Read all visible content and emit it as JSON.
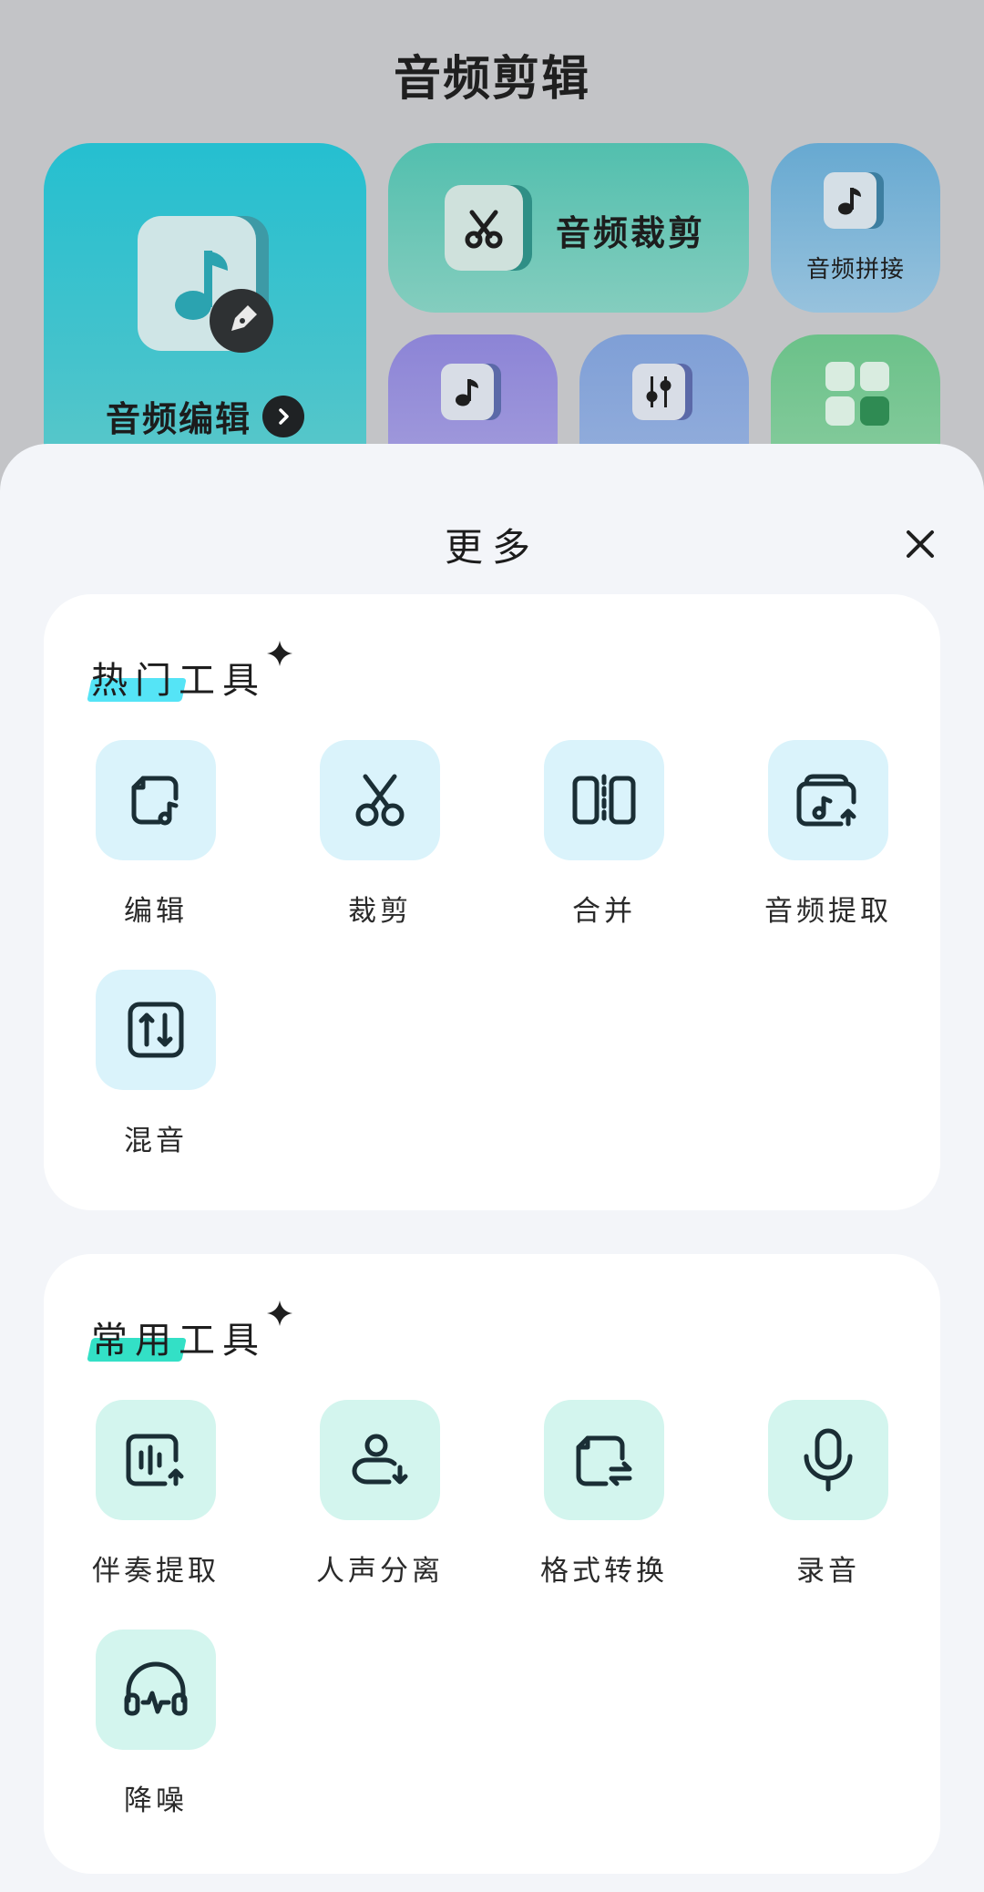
{
  "app": {
    "title": "音频剪辑"
  },
  "tiles": {
    "edit_label": "音频编辑",
    "cut_label": "音频裁剪",
    "join_label": "音频拼接"
  },
  "sheet": {
    "title": "更多",
    "close_icon": "close-icon",
    "sections": [
      {
        "title": "热门工具",
        "highlight_color": "#55e4f6",
        "tools": [
          {
            "label": "编辑",
            "icon": "music-file-edit-icon"
          },
          {
            "label": "裁剪",
            "icon": "scissors-icon"
          },
          {
            "label": "合并",
            "icon": "merge-icon"
          },
          {
            "label": "音频提取",
            "icon": "audio-extract-icon"
          },
          {
            "label": "混音",
            "icon": "mixer-icon"
          }
        ]
      },
      {
        "title": "常用工具",
        "highlight_color": "#33e0c6",
        "tools": [
          {
            "label": "伴奏提取",
            "icon": "accompaniment-extract-icon"
          },
          {
            "label": "人声分离",
            "icon": "vocal-separate-icon"
          },
          {
            "label": "格式转换",
            "icon": "format-convert-icon"
          },
          {
            "label": "录音",
            "icon": "microphone-icon"
          },
          {
            "label": "降噪",
            "icon": "headphones-noise-icon"
          }
        ]
      }
    ]
  }
}
